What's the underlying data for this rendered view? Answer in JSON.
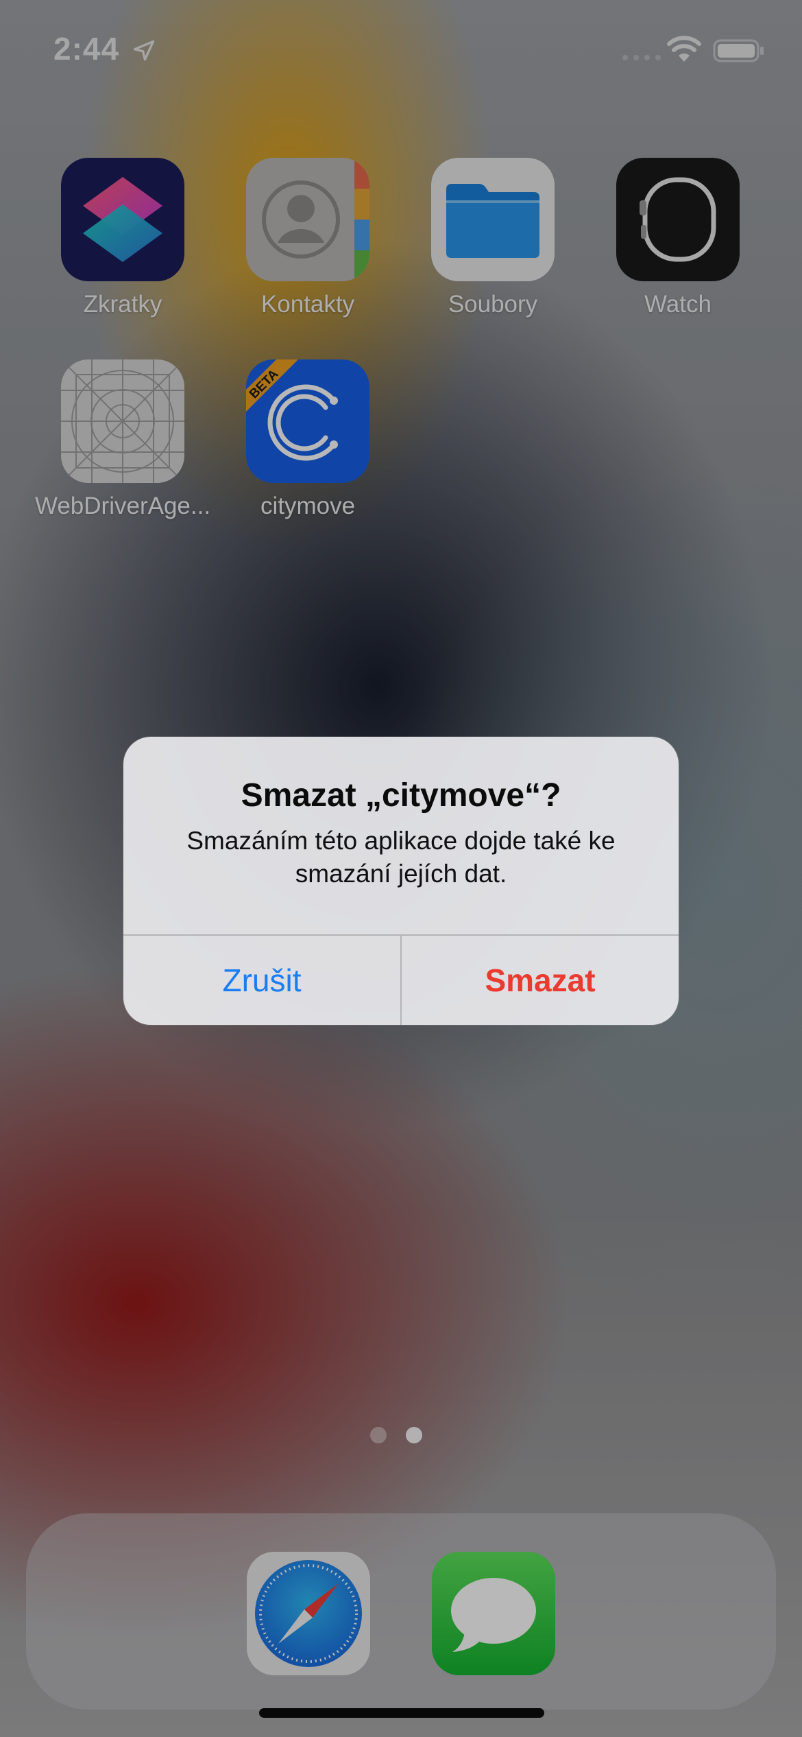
{
  "status_bar": {
    "time": "2:44",
    "icons": [
      "location-arrow-icon",
      "cellular-signal-icon",
      "wifi-icon",
      "battery-icon"
    ]
  },
  "apps": [
    {
      "label": "Zkratky",
      "icon": "shortcuts-icon"
    },
    {
      "label": "Kontakty",
      "icon": "contacts-icon"
    },
    {
      "label": "Soubory",
      "icon": "files-folder-icon"
    },
    {
      "label": "Watch",
      "icon": "watch-icon"
    },
    {
      "label": "WebDriverAge...",
      "icon": "blueprint-grid-icon"
    },
    {
      "label": "citymove",
      "icon": "citymove-icon",
      "badge": "BETA"
    }
  ],
  "page_indicator": {
    "count": 2,
    "current": 2
  },
  "dock": [
    {
      "icon": "safari-compass-icon"
    },
    {
      "icon": "messages-bubble-icon"
    }
  ],
  "alert": {
    "title": "Smazat „citymove“?",
    "message": "Smazáním této aplikace dojde také ke smazání jejích dat.",
    "cancel_label": "Zrušit",
    "confirm_label": "Smazat"
  },
  "colors": {
    "alert_button_blue": "#1a7df2",
    "alert_button_red": "#eb3b30",
    "citymove_blue": "#1760e8",
    "beta_ribbon": "#f0a020"
  }
}
